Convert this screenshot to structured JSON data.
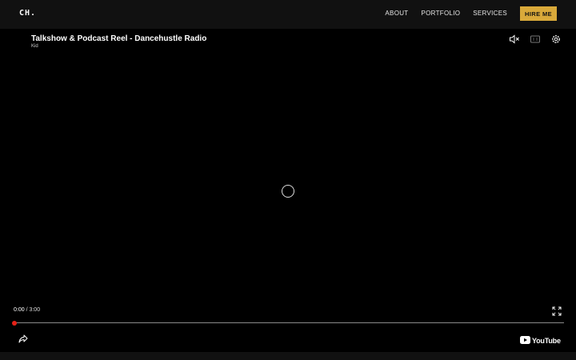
{
  "nav": {
    "logo": "CH.",
    "links": [
      "ABOUT",
      "PORTFOLIO",
      "SERVICES"
    ],
    "cta": "HIRE ME"
  },
  "player": {
    "title": "Talkshow & Podcast Reel - Dancehustle Radio",
    "channel": "Kid",
    "current_time": "0:00",
    "separator": " / ",
    "duration": "3:00",
    "progress": 0,
    "brand": "YouTube",
    "icons": [
      "mute-icon",
      "captions-icon",
      "settings-icon",
      "fullscreen-icon",
      "share-icon",
      "youtube-play-icon"
    ],
    "accent_color": "#e62117"
  },
  "colors": {
    "cta_bg": "#d9a93a",
    "nav_bg": "#111111"
  }
}
